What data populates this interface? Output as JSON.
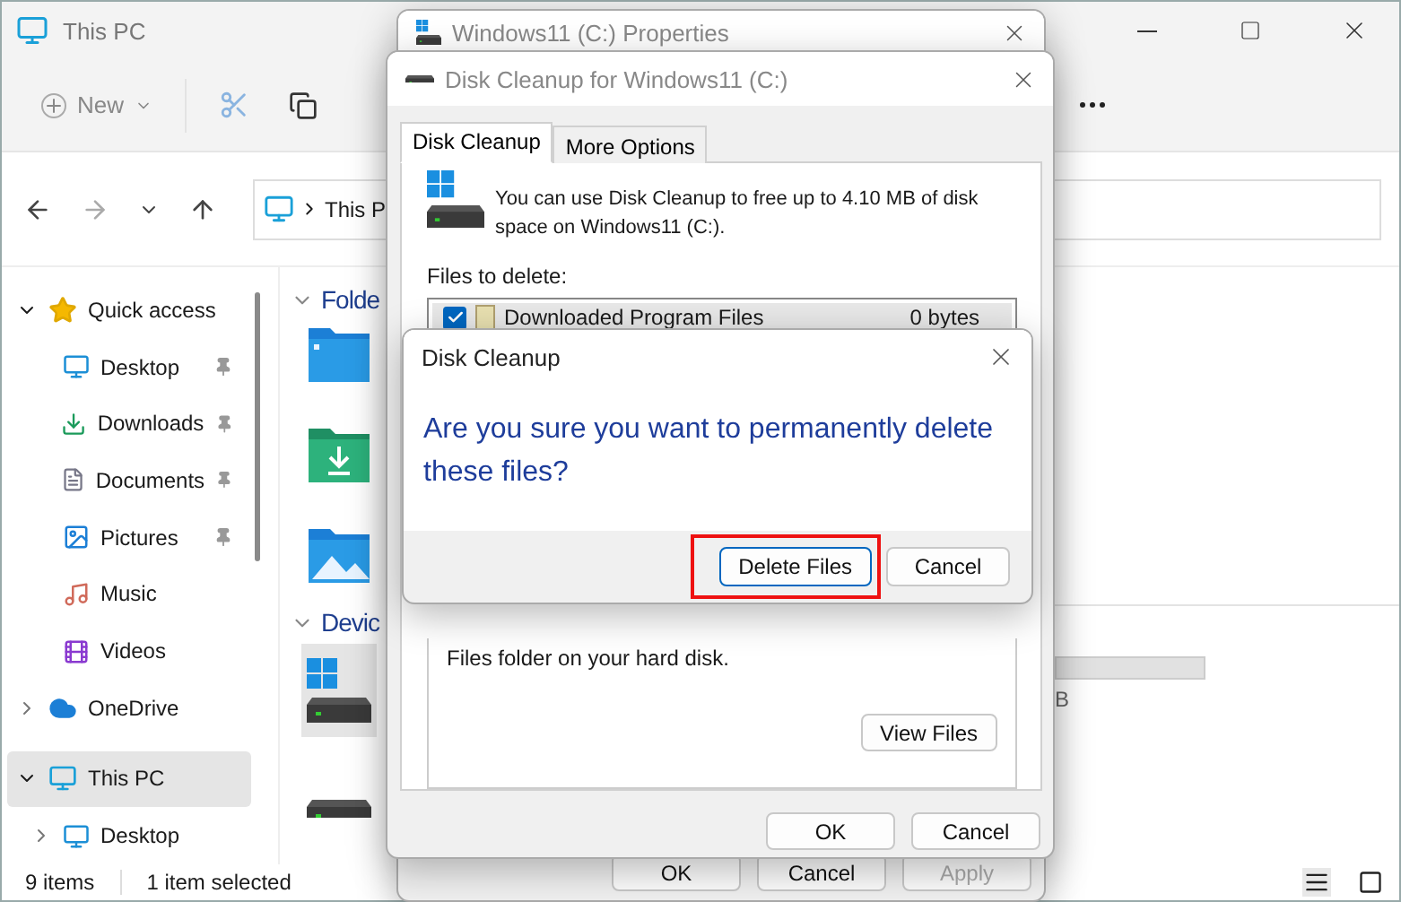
{
  "explorer": {
    "title": "This PC",
    "toolbar": {
      "new_label": "New"
    },
    "address": "This P",
    "sidebar": {
      "items": [
        {
          "label": "Quick access",
          "kind": "star",
          "expanded": true,
          "selected": false,
          "children": [
            {
              "label": "Desktop",
              "kind": "desktop",
              "pinned": true,
              "selected": false
            },
            {
              "label": "Downloads",
              "kind": "download",
              "pinned": true,
              "selected": false
            },
            {
              "label": "Documents",
              "kind": "documents",
              "pinned": true,
              "selected": false
            },
            {
              "label": "Pictures",
              "kind": "pictures",
              "pinned": true,
              "selected": false
            },
            {
              "label": "Music",
              "kind": "music",
              "pinned": false,
              "selected": false
            },
            {
              "label": "Videos",
              "kind": "videos",
              "pinned": false,
              "selected": false
            }
          ]
        },
        {
          "label": "OneDrive",
          "kind": "cloud",
          "expanded": false,
          "selected": false
        },
        {
          "label": "This PC",
          "kind": "pc",
          "expanded": true,
          "selected": true,
          "children": [
            {
              "label": "Desktop",
              "kind": "desktop",
              "expanded": false,
              "selected": false
            }
          ]
        }
      ]
    },
    "sections": [
      {
        "title": "Folde",
        "expanded": true,
        "items": [
          {
            "kind": "desktop",
            "selected": false
          },
          {
            "kind": "download",
            "selected": false
          },
          {
            "kind": "pictures",
            "selected": false
          }
        ]
      },
      {
        "title": "Devic",
        "expanded": true,
        "items": [
          {
            "kind": "windows-drive",
            "selected": true
          },
          {
            "kind": "drive",
            "selected": false
          }
        ]
      }
    ],
    "storage_label": "B",
    "status_bar": {
      "item_count": "9 items",
      "selection": "1 item selected"
    }
  },
  "properties_window": {
    "title": "Windows11 (C:) Properties",
    "buttons": [
      {
        "label": "OK",
        "disabled": false
      },
      {
        "label": "Cancel",
        "disabled": false
      },
      {
        "label": "Apply",
        "disabled": true
      }
    ]
  },
  "cleanup_window": {
    "title": "Disk Cleanup for Windows11 (C:)",
    "tabs": [
      {
        "label": "Disk Cleanup",
        "selected": true
      },
      {
        "label": "More Options",
        "selected": false
      }
    ],
    "summary": "You can use Disk Cleanup to free up to 4.10 MB of disk space on Windows11 (C:).",
    "files_label": "Files to delete:",
    "files": [
      {
        "name": "Downloaded Program Files",
        "size": "0 bytes",
        "checked": true
      }
    ],
    "description": "Files folder on your hard disk.",
    "view_files_button": "View Files",
    "buttons": [
      "OK",
      "Cancel"
    ]
  },
  "confirm_dialog": {
    "title": "Disk Cleanup",
    "message": "Are you sure you want to permanently delete these files?",
    "buttons": [
      {
        "label": "Delete Files",
        "highlighted": true
      },
      {
        "label": "Cancel",
        "highlighted": false
      }
    ]
  }
}
